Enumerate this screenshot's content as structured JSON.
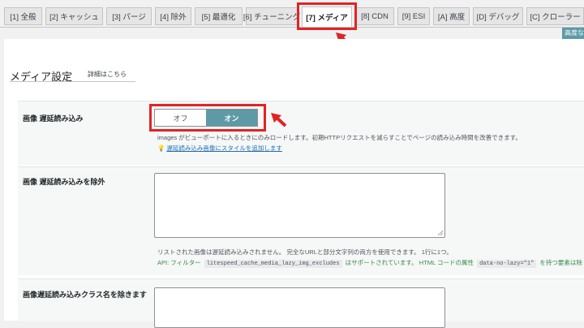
{
  "tabs": [
    {
      "label": "[1] 全般"
    },
    {
      "label": "[2] キャッシュ"
    },
    {
      "label": "[3] パージ"
    },
    {
      "label": "[4] 除外"
    },
    {
      "label": "[5] 最適化"
    },
    {
      "label": "[6] チューニング"
    },
    {
      "label": "[7] メディア"
    },
    {
      "label": "[8] CDN"
    },
    {
      "label": "[9] ESI"
    },
    {
      "label": "[A] 高度"
    },
    {
      "label": "[D] デバッグ"
    },
    {
      "label": "[C] クローラー"
    }
  ],
  "active_tab": "[7] メディア",
  "advanced_button": "高度な",
  "section": {
    "title": "メディア設定",
    "details_link": "詳細はこちら"
  },
  "lazyload": {
    "label": "画像 遅延読み込み",
    "toggle": {
      "off": "オフ",
      "on": "オン",
      "value": "オン"
    },
    "description": "images がビューポートに入るときにのみロードします。初期HTTPリクエストを減らすことでページの読み込み時間を改善できます。",
    "style_link": "遅延読み込み画像にスタイルを追加します"
  },
  "exclude": {
    "label": "画像 遅延読み込みを除外",
    "textarea_value": "",
    "description": "リストされた画像は遅延読み込みされません。 完全なURLと部分文字列の両方を使用できます。 1行に1つ。",
    "api_prefix": "API: フィルター",
    "api_filter": "litespeed_cache_media_lazy_img_excludes",
    "api_middle": "はサポートされています。 HTML コードの属性",
    "api_attr": "data-no-lazy=\"1\"",
    "api_suffix": "を持つ要素は除"
  },
  "class_exclude": {
    "label": "画像遅延読み込みクラス名を除きます"
  },
  "colors": {
    "accent": "#5d9aa6",
    "highlight": "#e02424",
    "link": "#2271b1",
    "api": "#3a8b4a"
  }
}
